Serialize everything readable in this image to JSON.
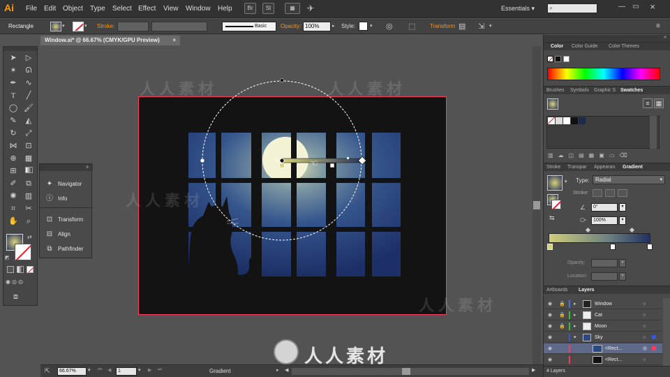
{
  "app": {
    "logo": "Ai",
    "workspace": "Essentials"
  },
  "menus": [
    "File",
    "Edit",
    "Object",
    "Type",
    "Select",
    "Effect",
    "View",
    "Window",
    "Help"
  ],
  "bridge_buttons": [
    "Br",
    "St"
  ],
  "control_bar": {
    "selection": "Rectangle",
    "stroke_label": "Stroke:",
    "stroke_style": "Basic",
    "opacity_label": "Opacity:",
    "opacity_value": "100%",
    "style_label": "Style:",
    "transform_label": "Transform"
  },
  "document_tab": {
    "title": "Window.ai* @ 66.67% (CMYK/GPU Preview)",
    "close": "×"
  },
  "flyout_panel": {
    "items": [
      {
        "label": "Navigator",
        "icon": "navigator-icon"
      },
      {
        "label": "Info",
        "icon": "info-icon"
      },
      {
        "label": "Transform",
        "icon": "transform-icon"
      },
      {
        "label": "Align",
        "icon": "align-icon"
      },
      {
        "label": "Pathfinder",
        "icon": "pathfinder-icon"
      }
    ]
  },
  "color_panel": {
    "tabs": [
      "Color",
      "Color Guide",
      "Color Themes"
    ]
  },
  "swatches_panel": {
    "tabs": [
      "Brushes",
      "Symbols",
      "Graphic S",
      "Swatches"
    ]
  },
  "gradient_panel": {
    "tabs": [
      "Stroke",
      "Transpar",
      "Appearan",
      "Gradient"
    ],
    "type_label": "Type:",
    "type_value": "Radial",
    "stroke_label": "Stroke:",
    "angle_value": "0°",
    "aspect_value": "100%",
    "opacity_label": "Opacity:",
    "location_label": "Location:"
  },
  "layers_panel": {
    "tabs": [
      "Artboards",
      "Layers"
    ],
    "layers": [
      {
        "name": "Window",
        "color": "#4f6fe8"
      },
      {
        "name": "Cat",
        "color": "#34c234"
      },
      {
        "name": "Moon",
        "color": "#34c234"
      },
      {
        "name": "Sky",
        "color": "#3a56d4"
      },
      {
        "name": "<Rect...",
        "color": "#ff3a5c"
      },
      {
        "name": "<Rect...",
        "color": "#ff3a5c"
      }
    ],
    "count": "4 Layers"
  },
  "status_bar": {
    "zoom": "66.67%",
    "page": "1",
    "tool": "Gradient"
  },
  "watermark": "人人素材",
  "colors": {
    "accent": "#f7941d",
    "artboard_border": "#ff3a5c",
    "moon": "#f4f3d6",
    "sky": "#2a4a87"
  }
}
